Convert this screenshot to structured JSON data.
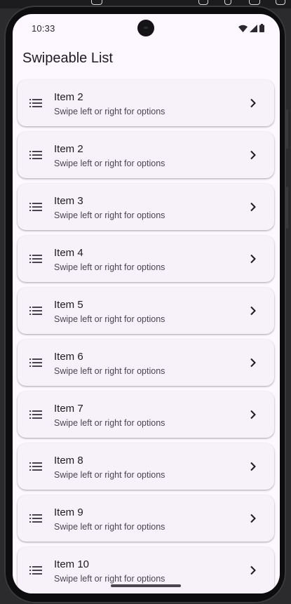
{
  "status_bar": {
    "time": "10:33"
  },
  "app_bar": {
    "title": "Swipeable List"
  },
  "items": [
    {
      "title": "Item 2",
      "subtitle": "Swipe left or right for options"
    },
    {
      "title": "Item 2",
      "subtitle": "Swipe left or right for options"
    },
    {
      "title": "Item 3",
      "subtitle": "Swipe left or right for options"
    },
    {
      "title": "Item 4",
      "subtitle": "Swipe left or right for options"
    },
    {
      "title": "Item 5",
      "subtitle": "Swipe left or right for options"
    },
    {
      "title": "Item 6",
      "subtitle": "Swipe left or right for options"
    },
    {
      "title": "Item 7",
      "subtitle": "Swipe left or right for options"
    },
    {
      "title": "Item 8",
      "subtitle": "Swipe left or right for options"
    },
    {
      "title": "Item 9",
      "subtitle": "Swipe left or right for options"
    },
    {
      "title": "Item 10",
      "subtitle": "Swipe left or right for options"
    }
  ],
  "icons": {
    "leading": "list-icon",
    "trailing": "chevron-right-icon"
  },
  "colors": {
    "background": "#fdf7ff",
    "card": "#f7f2fa",
    "text": "#1d1b20",
    "subtext": "#49454f"
  }
}
